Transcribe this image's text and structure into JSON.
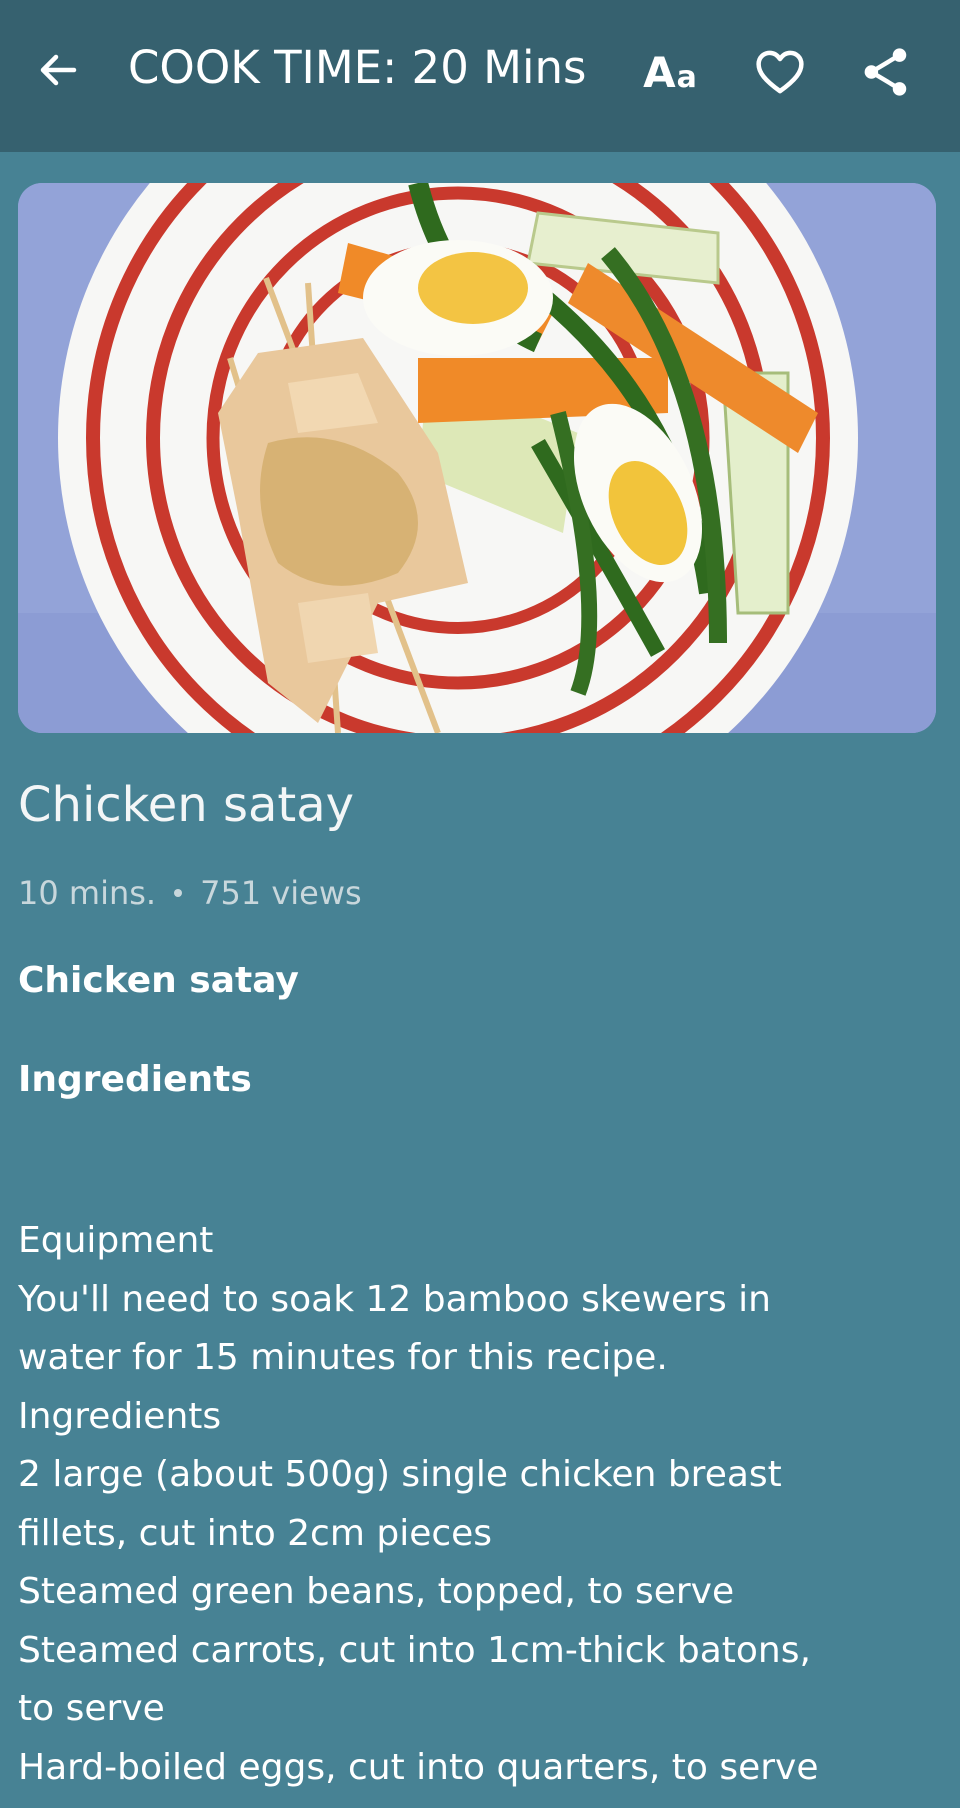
{
  "app_bar": {
    "title": "COOK TIME: 20 Mins",
    "icons": [
      "back-arrow-icon",
      "font-size-icon",
      "heart-icon",
      "share-icon"
    ],
    "font_icon_big": "A",
    "font_icon_small": "a"
  },
  "colors": {
    "app_bar_bg": "#36616f",
    "page_bg": "#478294"
  },
  "recipe": {
    "title": "Chicken satay",
    "duration": "10 mins.",
    "views": "751 views",
    "content_title": "Chicken satay",
    "ingredients_heading": "Ingredients",
    "body_lines": [
      "Equipment",
      " You'll need to soak 12 bamboo skewers in",
      "water for 15 minutes for this recipe.",
      "Ingredients",
      " 2 large (about 500g) single chicken breast",
      "fillets, cut into 2cm pieces",
      " Steamed green beans, topped, to serve",
      " Steamed carrots, cut into 1cm-thick batons,",
      "to serve",
      " Hard-boiled eggs, cut into quarters, to serve"
    ]
  }
}
